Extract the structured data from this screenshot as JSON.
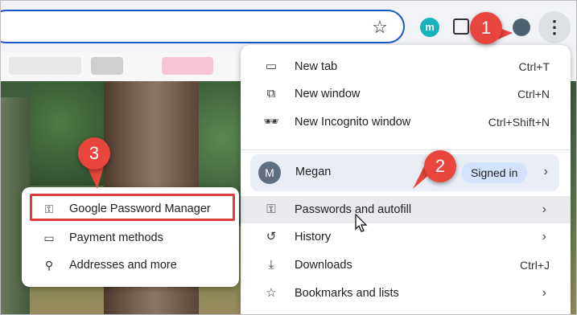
{
  "toolbar": {
    "extension_letter": "m"
  },
  "menu": {
    "items_top": [
      {
        "label": "New tab",
        "shortcut": "Ctrl+T",
        "icon": "new-tab-icon",
        "glyph": "▭"
      },
      {
        "label": "New window",
        "shortcut": "Ctrl+N",
        "icon": "new-window-icon",
        "glyph": "⧉"
      },
      {
        "label": "New Incognito window",
        "shortcut": "Ctrl+Shift+N",
        "icon": "incognito-icon",
        "glyph": "🕶"
      }
    ],
    "profile": {
      "initial": "M",
      "name": "Megan",
      "status": "Signed in"
    },
    "items_bottom": [
      {
        "label": "Passwords and autofill",
        "icon": "key-icon",
        "glyph": "⚿",
        "chevron": "›"
      },
      {
        "label": "History",
        "icon": "history-icon",
        "glyph": "↺",
        "chevron": "›"
      },
      {
        "label": "Downloads",
        "shortcut": "Ctrl+J",
        "icon": "download-icon",
        "glyph": "⤓"
      },
      {
        "label": "Bookmarks and lists",
        "icon": "star-icon",
        "glyph": "☆",
        "chevron": "›"
      }
    ]
  },
  "submenu": {
    "items": [
      {
        "label": "Google Password Manager",
        "icon": "key-icon",
        "glyph": "⚿"
      },
      {
        "label": "Payment methods",
        "icon": "credit-card-icon",
        "glyph": "▭"
      },
      {
        "label": "Addresses and more",
        "icon": "location-pin-icon",
        "glyph": "⚲"
      }
    ]
  },
  "callouts": {
    "one": "1",
    "two": "2",
    "three": "3"
  },
  "colors": {
    "callout": "#e8453c",
    "highlight_box": "#e03b3b",
    "signed_in_chip": "#d3e3fd"
  }
}
